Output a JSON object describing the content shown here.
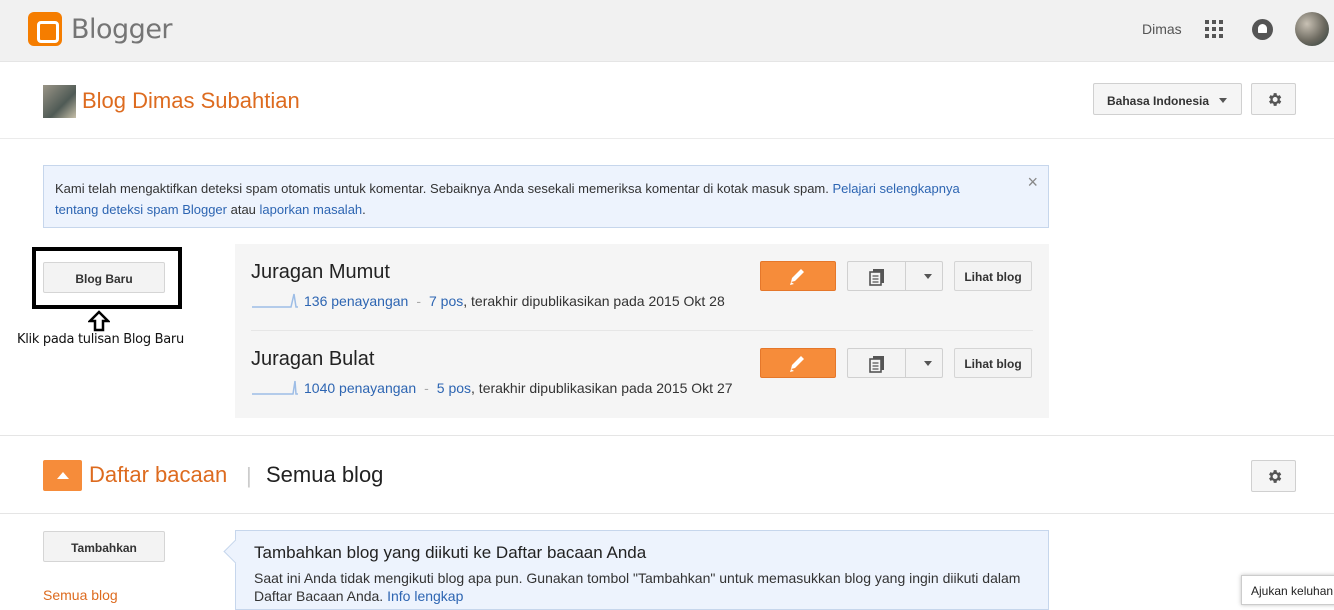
{
  "header": {
    "app_name": "Blogger",
    "user_name": "Dimas"
  },
  "blog": {
    "title": "Blog Dimas Subahtian",
    "language": "Bahasa Indonesia"
  },
  "notice": {
    "text": "Kami telah mengaktifkan deteksi spam otomatis untuk komentar. Sebaiknya Anda sesekali memeriksa komentar di kotak masuk spam. ",
    "link1": "Pelajari selengkapnya tentang deteksi spam Blogger",
    "mid": " atau ",
    "link2": "laporkan masalah",
    "end": ".",
    "close": "×"
  },
  "sidebar": {
    "new_blog": "Blog Baru",
    "annotation": "Klik pada tulisan Blog Baru"
  },
  "blogs": [
    {
      "name": "Juragan Mumut",
      "views": "136 penayangan",
      "posts": "7 pos",
      "published": ", terakhir dipublikasikan pada 2015 Okt 28",
      "view_label": "Lihat blog"
    },
    {
      "name": "Juragan Bulat",
      "views": "1040 penayangan",
      "posts": "5 pos",
      "published": ", terakhir dipublikasikan pada 2015 Okt 27",
      "view_label": "Lihat blog"
    }
  ],
  "reading_list": {
    "title": "Daftar bacaan",
    "separator": "|",
    "subtitle": "Semua blog",
    "add_button": "Tambahkan",
    "all_blogs": "Semua blog",
    "info_heading": "Tambahkan blog yang diikuti ke Daftar bacaan Anda",
    "info_text": "Saat ini Anda tidak mengikuti blog apa pun. Gunakan tombol \"Tambahkan\" untuk memasukkan blog yang ingin diikuti dalam Daftar Bacaan Anda. ",
    "info_link": "Info lengkap"
  },
  "feedback": {
    "label": "Ajukan keluhan"
  },
  "colors": {
    "brand_orange": "#f57d00",
    "accent_orange": "#f68c3a",
    "title_orange": "#dd6b1f",
    "link_blue": "#2d65b2"
  },
  "icons": [
    "blogger-logo-icon",
    "apps-grid-icon",
    "notifications-icon",
    "gear-icon",
    "pencil-icon",
    "document-icon",
    "chevron-down-icon",
    "close-icon",
    "arrow-up-icon",
    "collapse-icon"
  ]
}
